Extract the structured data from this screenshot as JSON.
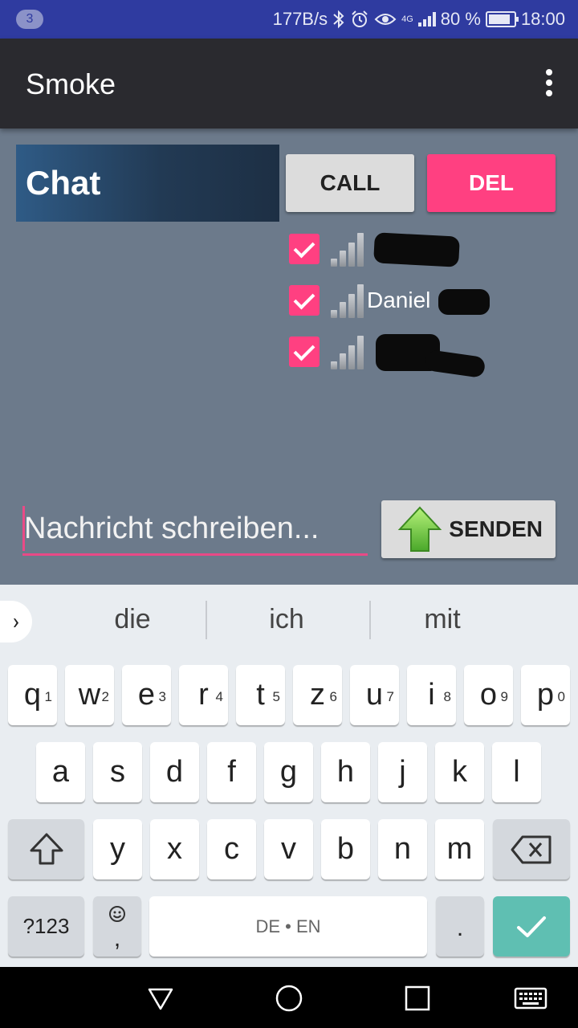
{
  "status_bar": {
    "notification_count": "3",
    "net_speed": "177B/s",
    "network_type": "4G",
    "battery": "80 %",
    "time": "18:00",
    "icons": [
      "bluetooth-icon",
      "alarm-icon",
      "eye-icon",
      "signal-icon",
      "battery-icon"
    ]
  },
  "app_bar": {
    "title": "Smoke",
    "menu_icon": "more-vert-icon"
  },
  "chat": {
    "header": "Chat",
    "call_label": "CALL",
    "del_label": "DEL",
    "contacts": [
      {
        "name": "",
        "checked": true,
        "signal_level": 0.75
      },
      {
        "name": "Daniel",
        "checked": true,
        "signal_level": 0.75
      },
      {
        "name": "",
        "checked": true,
        "signal_level": 0.75
      }
    ]
  },
  "composer": {
    "placeholder": "Nachricht schreiben...",
    "send_label": "SENDEN",
    "send_icon": "up-arrow-icon"
  },
  "keyboard": {
    "suggestions": [
      "die",
      "ich",
      "mit"
    ],
    "row1": [
      [
        "q",
        "1"
      ],
      [
        "w",
        "2"
      ],
      [
        "e",
        "3"
      ],
      [
        "r",
        "4"
      ],
      [
        "t",
        "5"
      ],
      [
        "z",
        "6"
      ],
      [
        "u",
        "7"
      ],
      [
        "i",
        "8"
      ],
      [
        "o",
        "9"
      ],
      [
        "p",
        "0"
      ]
    ],
    "row2": [
      "a",
      "s",
      "d",
      "f",
      "g",
      "h",
      "j",
      "k",
      "l"
    ],
    "row3": [
      "y",
      "x",
      "c",
      "v",
      "b",
      "n",
      "m"
    ],
    "symbols_label": "?123",
    "emoji_comma": ",",
    "space_label": "DE • EN",
    "period": ".",
    "colors": {
      "accent": "#ff4081",
      "enter": "#5fbfb2",
      "appbar": "#2a2a2f",
      "statusbar": "#2f3ba0",
      "content_bg": "#6c7a8b"
    }
  },
  "nav_bar": {
    "icons": [
      "back-icon",
      "home-icon",
      "recents-icon",
      "keyboard-icon"
    ]
  }
}
